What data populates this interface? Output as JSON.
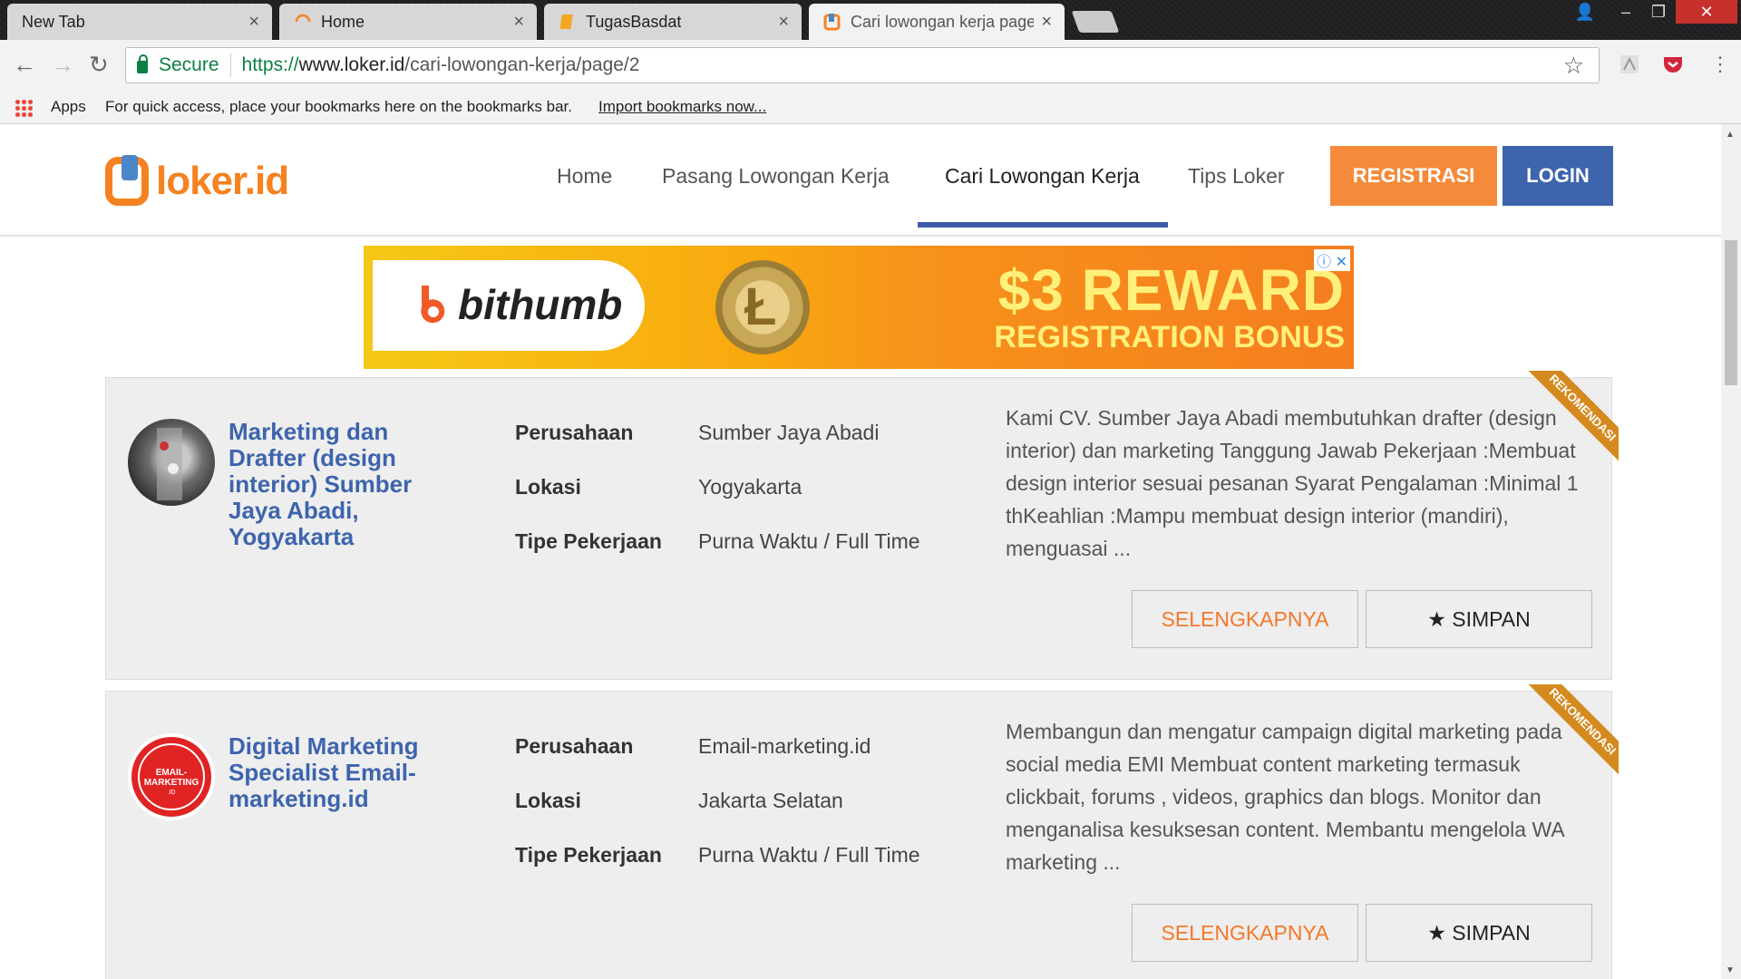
{
  "browser": {
    "tabs": [
      {
        "title": "New Tab",
        "active": false
      },
      {
        "title": "Home",
        "active": false
      },
      {
        "title": "TugasBasdat",
        "active": false
      },
      {
        "title": "Cari lowongan kerja page",
        "active": true
      }
    ],
    "close_glyph": "×",
    "window_controls": {
      "user": "👤",
      "minimize": "–",
      "restore": "❐",
      "close": "✕"
    },
    "secure_label": "Secure",
    "url": {
      "scheme": "https://",
      "host": "www.loker.id",
      "path": "/cari-lowongan-kerja/page/2"
    },
    "bookmarks": {
      "apps_label": "Apps",
      "message": "For quick access, place your bookmarks here on the bookmarks bar.",
      "import_link": "Import bookmarks now..."
    },
    "nav": {
      "back": "←",
      "forward": "→",
      "reload": "↻",
      "star": "☆"
    }
  },
  "site": {
    "logo_text": "loker.id",
    "nav": [
      {
        "label": "Home",
        "active": false
      },
      {
        "label": "Pasang Lowongan Kerja",
        "active": false
      },
      {
        "label": "Cari Lowongan Kerja",
        "active": true
      },
      {
        "label": "Tips Loker",
        "active": false
      }
    ],
    "register_label": "REGISTRASI",
    "login_label": "LOGIN",
    "colors": {
      "orange": "#f58b3a",
      "blue": "#3d64ad"
    }
  },
  "ad": {
    "brand": "bithumb",
    "headline": "$3 REWARD",
    "subheadline": "REGISTRATION BONUS",
    "close_label": "ⓘ ✕"
  },
  "jobs": [
    {
      "title": "Marketing dan Drafter (design interior) Sumber Jaya Abadi, Yogyakarta",
      "labels": {
        "company": "Perusahaan",
        "location": "Lokasi",
        "type": "Tipe Pekerjaan"
      },
      "company": "Sumber Jaya Abadi",
      "location": "Yogyakarta",
      "type": "Purna Waktu / Full Time",
      "description": "Kami CV. Sumber Jaya Abadi membutuhkan drafter (design interior) dan marketing Tanggung Jawab Pekerjaan :Membuat design interior sesuai pesanan Syarat Pengalaman :Minimal 1 thKeahlian :Mampu membuat design interior (mandiri), menguasai ...",
      "more_label": "SELENGKAPNYA",
      "save_label": "★ SIMPAN",
      "ribbon": "REKOMENDASI"
    },
    {
      "title": "Digital Marketing Specialist Email-marketing.id",
      "labels": {
        "company": "Perusahaan",
        "location": "Lokasi",
        "type": "Tipe Pekerjaan"
      },
      "company": "Email-marketing.id",
      "location": "Jakarta Selatan",
      "type": "Purna Waktu / Full Time",
      "description": "Membangun dan mengatur campaign digital marketing pada social media EMI Membuat content marketing termasuk clickbait, forums , videos, graphics dan blogs. Monitor dan menganalisa kesuksesan content. Membantu mengelola WA marketing ...",
      "more_label": "SELENGKAPNYA",
      "save_label": "★ SIMPAN",
      "ribbon": "REKOMENDASI",
      "logo_text": "EMAIL-MARKETING.ID"
    }
  ]
}
